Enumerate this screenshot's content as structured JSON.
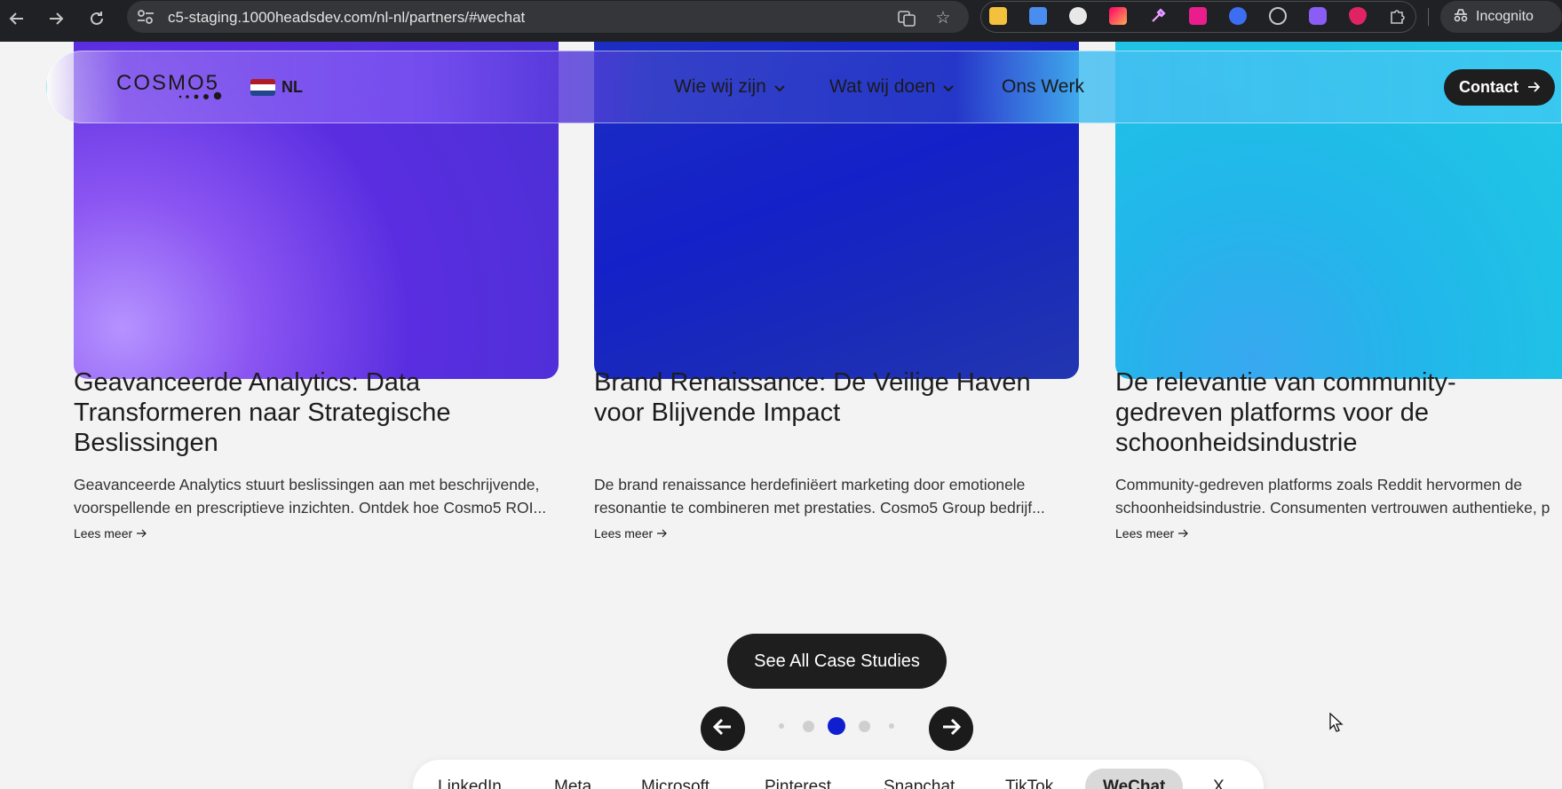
{
  "browser": {
    "url": "c5-staging.1000headsdev.com/nl-nl/partners/#wechat",
    "profile_label": "Incognito"
  },
  "nav": {
    "logo_text": "COSMO5",
    "language": "NL",
    "menu": [
      {
        "label": "Wie wij zijn",
        "has_dropdown": true
      },
      {
        "label": "Wat wij doen",
        "has_dropdown": true
      },
      {
        "label": "Ons Werk",
        "has_dropdown": false
      }
    ],
    "contact_label": "Contact"
  },
  "cards": [
    {
      "title": "Geavanceerde Analytics: Data Transformeren naar Strategische Beslissingen",
      "description": "Geavanceerde Analytics stuurt beslissingen aan met beschrijvende, voorspellende en prescriptieve inzichten. Ontdek hoe Cosmo5 ROI...",
      "link": "Lees meer"
    },
    {
      "title": "Brand Renaissance: De Veilige Haven voor Blijvende Impact",
      "description": "De brand renaissance herdefiniëert marketing door emotionele resonantie te combineren met prestaties. Cosmo5 Group bedrijf...",
      "link": "Lees meer"
    },
    {
      "title": "De relevantie van community-gedreven platforms voor de schoonheidsindustrie",
      "description": "Community-gedreven platforms zoals Reddit hervormen de schoonheidsindustrie. Consumenten vertrouwen authentieke, p",
      "link": "Lees meer"
    }
  ],
  "cta_label": "See All Case Studies",
  "carousel": {
    "active_index": 2,
    "dot_count": 5
  },
  "partner_tabs": {
    "items": [
      "LinkedIn",
      "Meta",
      "Microsoft",
      "Pinterest",
      "Snapchat",
      "TikTok",
      "WeChat",
      "X"
    ],
    "active": "WeChat"
  },
  "colors": {
    "accent_dot": "#0f1fd0",
    "button_dark": "#1e1e1e"
  }
}
